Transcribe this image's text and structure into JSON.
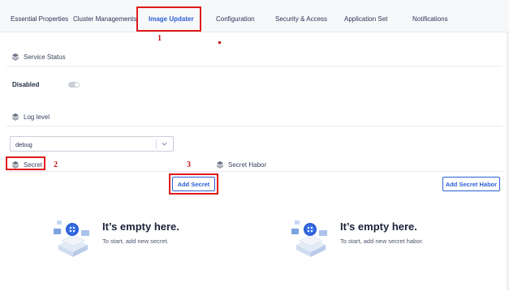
{
  "tabs": [
    {
      "label": "Essential Properties",
      "active": false
    },
    {
      "label": "Cluster Managements",
      "active": false
    },
    {
      "label": "Image Updater",
      "active": true
    },
    {
      "label": "Configuration",
      "active": false
    },
    {
      "label": "Security & Access",
      "active": false
    },
    {
      "label": "Application Set",
      "active": false
    },
    {
      "label": "Notifications",
      "active": false
    }
  ],
  "annotations": {
    "one": "1",
    "two": "2",
    "three": "3"
  },
  "service_status": {
    "heading": "Service Status",
    "toggle_label": "Disabled",
    "enabled": false
  },
  "log_level": {
    "heading": "Log level",
    "selected": "debug"
  },
  "secret_tabs": {
    "secret": "Secret",
    "secret_habor": "Secret Habor"
  },
  "buttons": {
    "add_secret": "Add Secret",
    "add_secret_habor": "Add Secret Habor"
  },
  "empty_states": [
    {
      "title": "It’s empty here.",
      "subtitle": "To start, add new secret."
    },
    {
      "title": "It’s empty here.",
      "subtitle": "To start, add new secret habor."
    }
  ],
  "colors": {
    "accent": "#2c5fd6",
    "annotation": "#e01b1b",
    "tab_bar": "#f7f8fa"
  },
  "icons": {
    "section": "layers-icon",
    "select": "chevron-down-icon",
    "empty": "empty-box-illustration"
  }
}
